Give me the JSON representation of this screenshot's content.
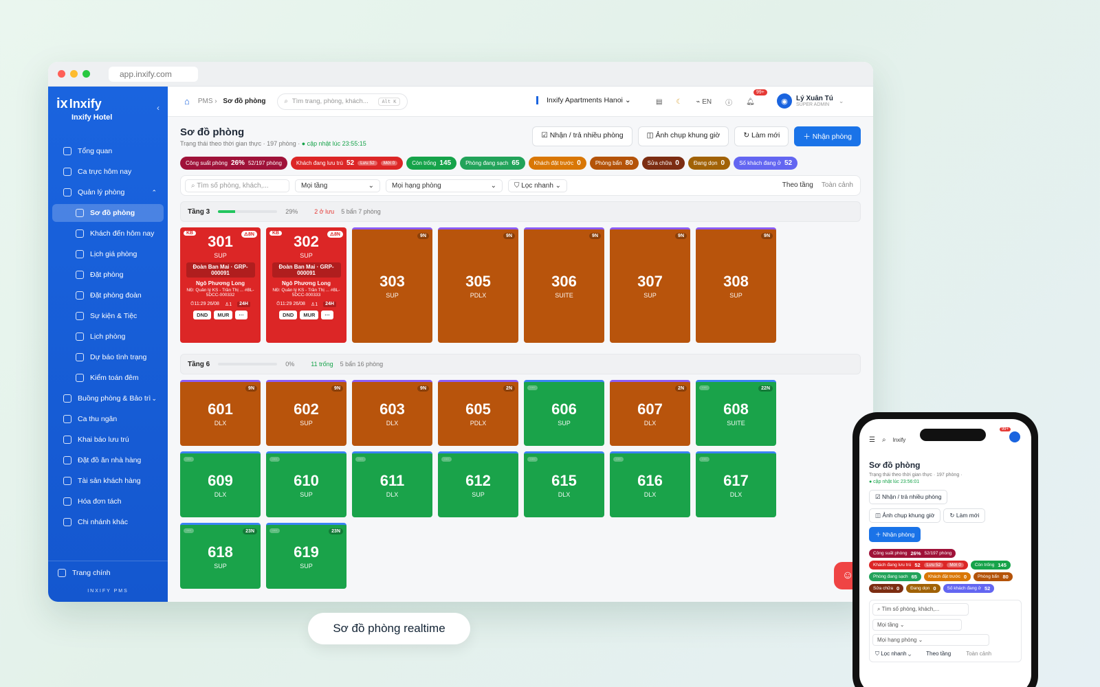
{
  "browser": {
    "url": "app.inxify.com"
  },
  "brand": {
    "name": "Inxify",
    "hotel": "Inxify Hotel",
    "footer": "INXIFY PMS"
  },
  "nav": [
    {
      "label": "Tổng quan",
      "type": "top"
    },
    {
      "label": "Ca trực hôm nay",
      "type": "top"
    },
    {
      "label": "Quản lý phòng",
      "type": "group",
      "chev": "⌃"
    },
    {
      "label": "Sơ đồ phòng",
      "type": "active"
    },
    {
      "label": "Khách đến hôm nay",
      "type": "sub"
    },
    {
      "label": "Lịch giá phòng",
      "type": "sub"
    },
    {
      "label": "Đặt phòng",
      "type": "sub"
    },
    {
      "label": "Đặt phòng đoàn",
      "type": "sub"
    },
    {
      "label": "Sự kiện & Tiệc",
      "type": "sub"
    },
    {
      "label": "Lịch phòng",
      "type": "sub"
    },
    {
      "label": "Dự báo tình trạng",
      "type": "sub"
    },
    {
      "label": "Kiểm toán đêm",
      "type": "sub"
    },
    {
      "label": "Buồng phòng & Bảo trì",
      "type": "group",
      "chev": "⌄"
    },
    {
      "label": "Ca thu ngân",
      "type": "top"
    },
    {
      "label": "Khai báo lưu trú",
      "type": "top"
    },
    {
      "label": "Đặt đồ ăn nhà hàng",
      "type": "top"
    },
    {
      "label": "Tài sản khách hàng",
      "type": "top"
    },
    {
      "label": "Hóa đơn tách",
      "type": "top"
    },
    {
      "label": "Chi nhánh khác",
      "type": "top"
    }
  ],
  "side_bottom": "Trang chính",
  "topbar": {
    "crumb1": "PMS",
    "crumb2": "Sơ đồ phòng",
    "search": "Tìm trang, phòng, khách...",
    "shortcut": "Alt K",
    "property": "Inxify Apartments Hanoi",
    "lang": "EN",
    "notif": "99+",
    "user": "Lý Xuân Tú",
    "role": "SUPER ADMIN"
  },
  "page": {
    "title": "Sơ đồ phòng",
    "subtitle": "Trạng thái theo thời gian thực · 197 phòng",
    "updated": "● cập nhật lúc 23:55:15"
  },
  "actions": {
    "multi": "Nhận / trả nhiều phòng",
    "snapshot": "Ảnh chụp khung giờ",
    "refresh": "Làm mới",
    "checkin": "Nhận phòng"
  },
  "stats": [
    {
      "label": "Công suất phòng",
      "value": "26%",
      "extra": "52/197 phòng",
      "color": "#9f1239"
    },
    {
      "label": "Khách đang lưu trú",
      "value": "52",
      "mini1": "Lưu 52",
      "mini2": "Mới 0",
      "color": "#dc2626"
    },
    {
      "label": "Còn trống",
      "value": "145",
      "color": "#16a34a"
    },
    {
      "label": "Phòng đang sạch",
      "value": "65",
      "color": "#22a35a"
    },
    {
      "label": "Khách đặt trước",
      "value": "0",
      "color": "#d97706"
    },
    {
      "label": "Phòng bẩn",
      "value": "80",
      "color": "#b45309"
    },
    {
      "label": "Sửa chữa",
      "value": "0",
      "color": "#7c2d12"
    },
    {
      "label": "Đang dọn",
      "value": "0",
      "color": "#a16207"
    },
    {
      "label": "Số khách đang ở",
      "value": "52",
      "color": "#6366f1"
    }
  ],
  "filters": {
    "search": "Tìm số phòng, khách,...",
    "floor": "Mọi tầng",
    "type": "Mọi hạng phòng",
    "quick": "Lọc nhanh",
    "view1": "Theo tầng",
    "view2": "Toàn cảnh"
  },
  "floors": [
    {
      "name": "Tầng 3",
      "pct": "29%",
      "fill": 0.29,
      "note": "2 ở lưu",
      "noteColor": "#e53935",
      "info": "5 bẩn  7 phòng",
      "rooms": [
        {
          "no": "301",
          "type": "SUP",
          "status": "occupied",
          "tag": "⚠8N",
          "tagl": "KB",
          "group": "Đoàn Ban Mai · GRP-000091",
          "guest": "Ngô Phương Long",
          "note": "NĐ: Quản lý KS - Trần Thị ... #BL-5DCC-000332",
          "time": "⏱11:29 26/08",
          "pax": "1",
          "dur": "24H",
          "b1": "DND",
          "b2": "MUR",
          "b3": "···"
        },
        {
          "no": "302",
          "type": "SUP",
          "status": "occupied",
          "tag": "⚠8N",
          "tagl": "KB",
          "group": "Đoàn Ban Mai · GRP-000091",
          "guest": "Ngô Phương Long",
          "note": "NĐ: Quản lý KS - Trần Thị ... #BL-5DCC-000333",
          "time": "⏱11:29 26/08",
          "pax": "1",
          "dur": "24H",
          "b1": "DND",
          "b2": "MUR",
          "b3": "···"
        },
        {
          "no": "303",
          "type": "SUP",
          "status": "dirty",
          "tag": "9N"
        },
        {
          "no": "305",
          "type": "PDLX",
          "status": "dirty",
          "tag": "9N"
        },
        {
          "no": "306",
          "type": "SUITE",
          "status": "dirty",
          "tag": "9N"
        },
        {
          "no": "307",
          "type": "SUP",
          "status": "dirty",
          "tag": "9N"
        },
        {
          "no": "308",
          "type": "SUP",
          "status": "dirty",
          "tag": "9N"
        }
      ]
    },
    {
      "name": "Tầng 6",
      "pct": "0%",
      "fill": 0,
      "note": "11 trống",
      "noteColor": "#16a34a",
      "info": "5 bẩn  16 phòng",
      "rooms": [
        {
          "no": "601",
          "type": "DLX",
          "status": "dirty",
          "tag": "9N"
        },
        {
          "no": "602",
          "type": "SUP",
          "status": "dirty",
          "tag": "9N"
        },
        {
          "no": "603",
          "type": "DLX",
          "status": "dirty",
          "tag": "9N"
        },
        {
          "no": "605",
          "type": "PDLX",
          "status": "dirty",
          "tag": "2N"
        },
        {
          "no": "606",
          "type": "SUP",
          "status": "clean",
          "tagl": "···"
        },
        {
          "no": "607",
          "type": "DLX",
          "status": "dirty",
          "tag": "2N"
        },
        {
          "no": "608",
          "type": "SUITE",
          "status": "clean",
          "tag": "22N",
          "tagl": "···"
        },
        {
          "no": "609",
          "type": "DLX",
          "status": "clean",
          "tagl": "···"
        },
        {
          "no": "610",
          "type": "SUP",
          "status": "clean",
          "tagl": "···"
        },
        {
          "no": "611",
          "type": "DLX",
          "status": "clean",
          "tagl": "···"
        },
        {
          "no": "612",
          "type": "SUP",
          "status": "clean",
          "tagl": "···"
        },
        {
          "no": "615",
          "type": "DLX",
          "status": "clean",
          "tagl": "···"
        },
        {
          "no": "616",
          "type": "DLX",
          "status": "clean",
          "tagl": "···"
        },
        {
          "no": "617",
          "type": "DLX",
          "status": "clean",
          "tagl": "···"
        },
        {
          "no": "618",
          "type": "SUP",
          "status": "clean",
          "tag": "23N",
          "tagl": "···"
        },
        {
          "no": "619",
          "type": "SUP",
          "status": "clean",
          "tag": "23N",
          "tagl": "···"
        }
      ]
    }
  ],
  "caption": "Sơ đồ phòng realtime",
  "phone": {
    "search": "Inxify",
    "notif": "99+",
    "title": "Sơ đồ phòng",
    "subtitle": "Trạng thái theo thời gian thực · 197 phòng",
    "updated": "● cập nhật lúc 23:56:01",
    "search_ph": "Tìm số phòng, khách,..."
  }
}
